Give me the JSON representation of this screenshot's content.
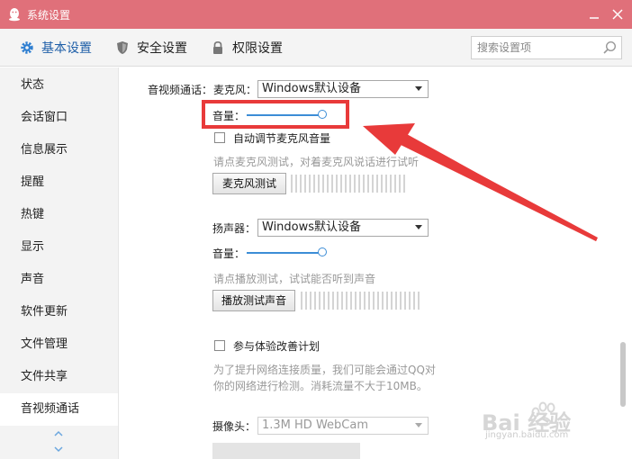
{
  "window": {
    "title": "系统设置"
  },
  "tabs": [
    {
      "label": "基本设置",
      "icon": "gear-icon"
    },
    {
      "label": "安全设置",
      "icon": "shield-icon"
    },
    {
      "label": "权限设置",
      "icon": "lock-icon"
    }
  ],
  "search": {
    "placeholder": "搜索设置项"
  },
  "sidebar": {
    "items": [
      {
        "label": "状态"
      },
      {
        "label": "会话窗口"
      },
      {
        "label": "信息展示"
      },
      {
        "label": "提醒"
      },
      {
        "label": "热键"
      },
      {
        "label": "显示"
      },
      {
        "label": "声音"
      },
      {
        "label": "软件更新"
      },
      {
        "label": "文件管理"
      },
      {
        "label": "文件共享"
      },
      {
        "label": "音视频通话"
      }
    ],
    "active": "音视频通话"
  },
  "av": {
    "section_label": "音视频通话：",
    "mic_label": "麦克风：",
    "mic_device": "Windows默认设备",
    "mic_volume_label": "音量：",
    "mic_volume_level": 0.85,
    "auto_adjust_label": "自动调节麦克风音量",
    "auto_adjust_checked": false,
    "mic_hint": "请点麦克风测试，对着麦克风说话进行试听",
    "mic_test_button": "麦克风测试",
    "speaker_label": "扬声器：",
    "speaker_device": "Windows默认设备",
    "speaker_volume_label": "音量：",
    "speaker_volume_level": 0.85,
    "speaker_hint": "请点播放测试，试试能否听到声音",
    "speaker_test_button": "播放测试声音",
    "experience_label": "参与体验改善计划",
    "experience_checked": false,
    "experience_desc_1": "为了提升网络连接质量，我们可能会通过QQ对",
    "experience_desc_2": "你的网络进行检测。消耗流量不大于10MB。",
    "camera_label": "摄像头：",
    "camera_device": "1.3M HD WebCam"
  },
  "watermark": {
    "text": "Bai 经验",
    "url_text": "jingyan.baidu.com"
  },
  "colors": {
    "titlebar": "#e0707a",
    "accent": "#3c8dd6",
    "annotation": "#e83a3a"
  }
}
